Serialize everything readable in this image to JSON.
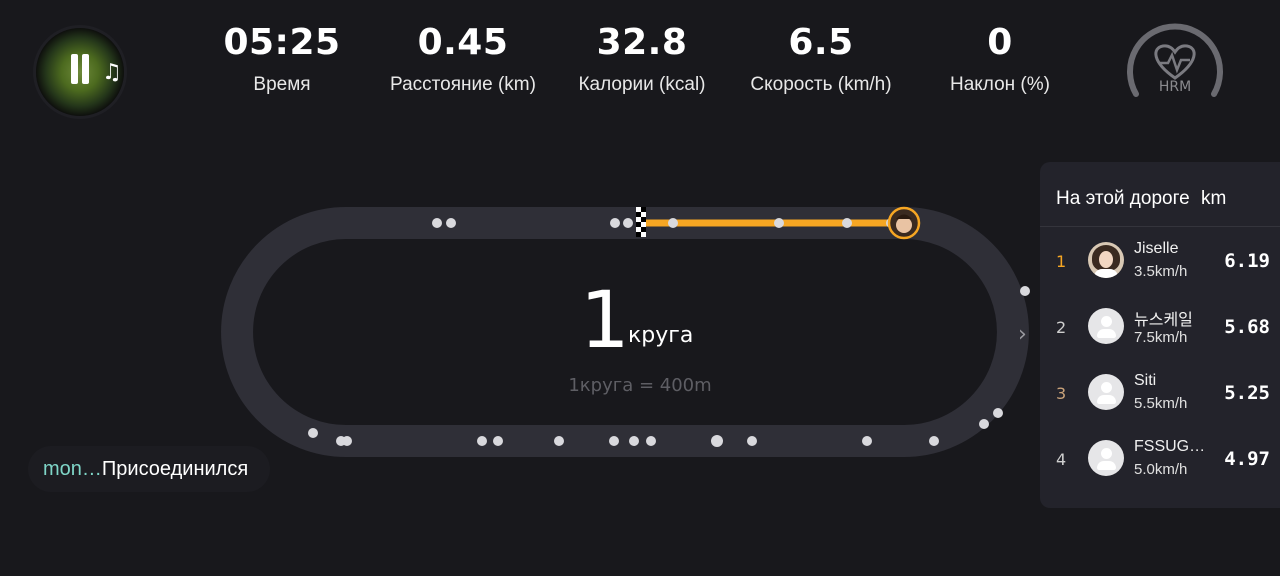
{
  "player": {
    "music_note_icon": "♫",
    "pause_icon": "pause"
  },
  "stats": [
    {
      "value": "05:25",
      "label": "Время"
    },
    {
      "value": "0.45",
      "label": "Расстояние (km)"
    },
    {
      "value": "32.8",
      "label": "Калории (kcal)"
    },
    {
      "value": "6.5",
      "label": "Скорость (km/h)"
    },
    {
      "value": "0",
      "label": "Наклон (%)"
    }
  ],
  "hrm": {
    "label": "HRM",
    "icon": "heart-pulse-icon"
  },
  "track": {
    "lap_count": "1",
    "lap_word": "круга",
    "lap_info": "1круга = 400m",
    "progress_fraction": 0.16,
    "colors": {
      "track": "#2f2f37",
      "progress": "#f6a623",
      "runner_dot": "#d9d9dd"
    }
  },
  "leaderboard": {
    "title": "На этой дороге",
    "unit": "km",
    "rows": [
      {
        "rank": "1",
        "name": "Jiselle",
        "speed": "3.5km/h",
        "distance": "6.19"
      },
      {
        "rank": "2",
        "name": "뉴스케일",
        "speed": "7.5km/h",
        "distance": "5.68"
      },
      {
        "rank": "3",
        "name": "Siti",
        "speed": "5.5km/h",
        "distance": "5.25"
      },
      {
        "rank": "4",
        "name": "FSSUG…",
        "speed": "5.0km/h",
        "distance": "4.97"
      }
    ],
    "expand_icon": "chevron-right-icon"
  },
  "toast": {
    "user": "mon…",
    "message": "Присоединился"
  }
}
